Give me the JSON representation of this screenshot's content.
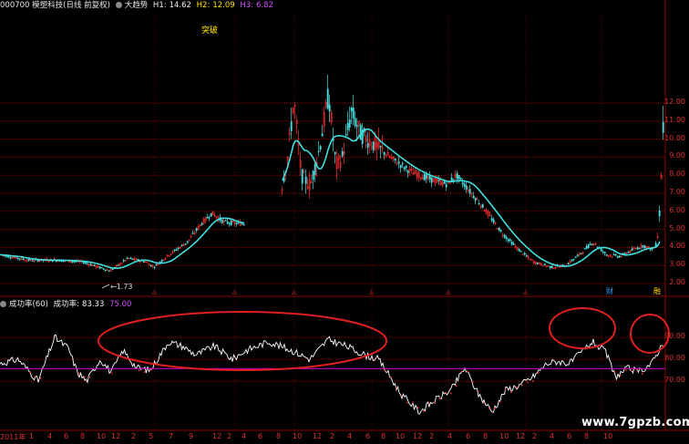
{
  "header": {
    "stock": "000700 模塑科技(日线 前复权)",
    "indicator": "大趋势",
    "h1_label": "H1:",
    "h1": "14.62",
    "h2_label": "H2:",
    "h2": "12.09",
    "h3_label": "H3:",
    "h3": "6.82"
  },
  "annotation_tupo": "突破",
  "sub_header": {
    "indicator": "成功率(60)",
    "label": "成功率:",
    "value": "83.33",
    "ref_value": "75.00"
  },
  "y_axis_main": [
    "12.00",
    "11.00",
    "10.00",
    "9.00",
    "8.00",
    "7.00",
    "6.00",
    "5.00",
    "4.00",
    "3.00",
    "2.00"
  ],
  "y_axis_sub": [
    "90.00",
    "80.00",
    "70.00"
  ],
  "x_axis": [
    "2011年",
    "1",
    "4",
    "6",
    "8",
    "10",
    "12",
    "2",
    "5",
    "7",
    "9",
    "12",
    "2",
    "4",
    "6",
    "8",
    "10",
    "12",
    "2",
    "4",
    "6",
    "8",
    "10",
    "12",
    "2",
    "4",
    "6",
    "8",
    "10",
    "12",
    "2",
    "4",
    "6",
    "8",
    "10"
  ],
  "low_marker": "1.73",
  "markers": [
    "财",
    "融"
  ],
  "watermark": "www.7gpzb.com",
  "colors": {
    "background": "#000000",
    "grid": "#8b0000",
    "ma_line": "#40e0e0",
    "success_line": "#ffffff",
    "threshold_line": "#c000c0",
    "ellipse": "#e02020",
    "up_candle": "#ff3030",
    "down_candle": "#40e0e0"
  }
}
